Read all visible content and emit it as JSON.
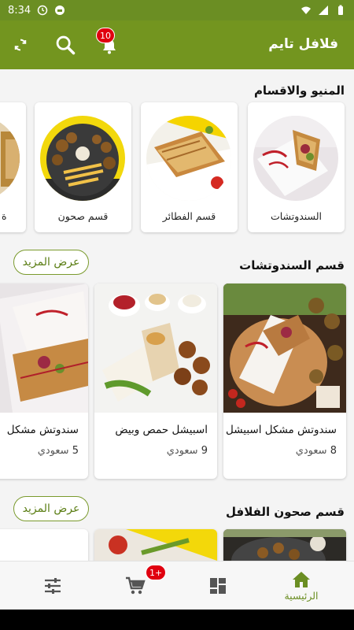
{
  "status_bar": {
    "time": "8:34"
  },
  "app_bar": {
    "title": "فلافل تايم",
    "notification_count": "10",
    "icons": [
      "refresh-icon",
      "search-icon",
      "bell-icon"
    ]
  },
  "categories_section": {
    "title": "المنيو والاقسام",
    "items": [
      {
        "label": "السندوتشات",
        "icon": "sandwich-image"
      },
      {
        "label": "قسم الفطائر",
        "icon": "pie-image"
      },
      {
        "label": "قسم صحون",
        "icon": "plate-image"
      },
      {
        "label": "ة",
        "icon": "partial-image"
      }
    ]
  },
  "sandwiches_section": {
    "title": "قسم السندوتشات",
    "more_label": "عرض المزيد",
    "products": [
      {
        "name": "سندوتش مشكل اسبيشل",
        "price": "8",
        "currency": "سعودي"
      },
      {
        "name": "اسبيشل حمص وبيض",
        "price": "9",
        "currency": "سعودي"
      },
      {
        "name": "سندوتش مشكل",
        "price": "5",
        "currency": "سعودي"
      }
    ]
  },
  "plates_section": {
    "title": "قسم صحون الفلافل",
    "more_label": "عرض المزيد"
  },
  "bottom_nav": {
    "home_label": "الرئيسية",
    "cart_count": "1+",
    "items": [
      "home-icon",
      "grid-icon",
      "cart-icon",
      "filter-icon"
    ]
  },
  "colors": {
    "primary": "#73951f",
    "accent_text": "#5a7d13",
    "badge": "#e0000f"
  }
}
